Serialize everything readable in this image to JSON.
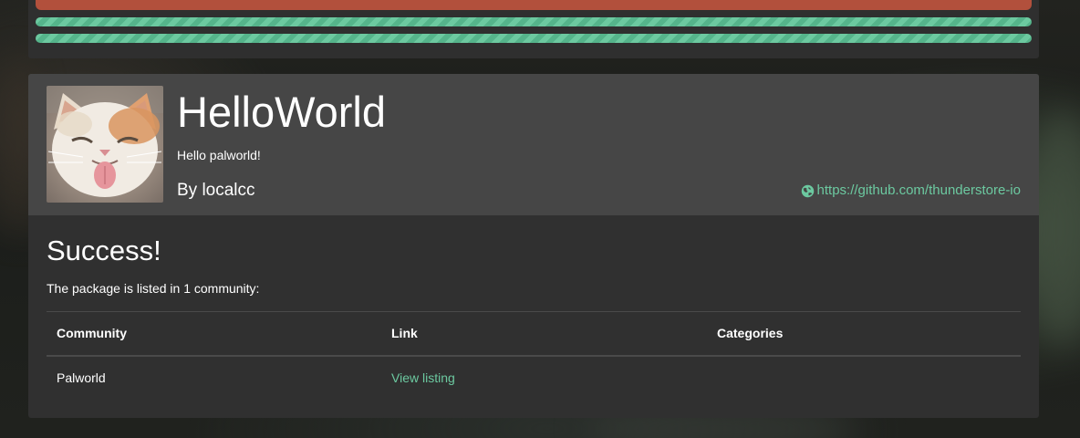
{
  "progress": {
    "bars": [
      {
        "status": "error",
        "color": "#b2503c",
        "progress": 1.0
      },
      {
        "status": "success",
        "color": "#6cc9a0",
        "progress": 1.0
      },
      {
        "status": "success",
        "color": "#6cc9a0",
        "progress": 1.0
      }
    ]
  },
  "package": {
    "name": "HelloWorld",
    "description": "Hello palworld!",
    "author": "By localcc",
    "website": "https://github.com/thunderstore-io",
    "website_icon": "globe-icon",
    "avatar_icon": "cat-photo"
  },
  "result": {
    "title": "Success!",
    "message": "The package is listed in 1 community:",
    "table": {
      "headers": [
        "Community",
        "Link",
        "Categories"
      ],
      "rows": [
        {
          "community": "Palworld",
          "link": "View listing",
          "categories": ""
        }
      ]
    }
  },
  "colors": {
    "accent": "#6cc9a0",
    "error": "#b2503c",
    "card_bg": "#303030",
    "header_bg": "#464646"
  }
}
